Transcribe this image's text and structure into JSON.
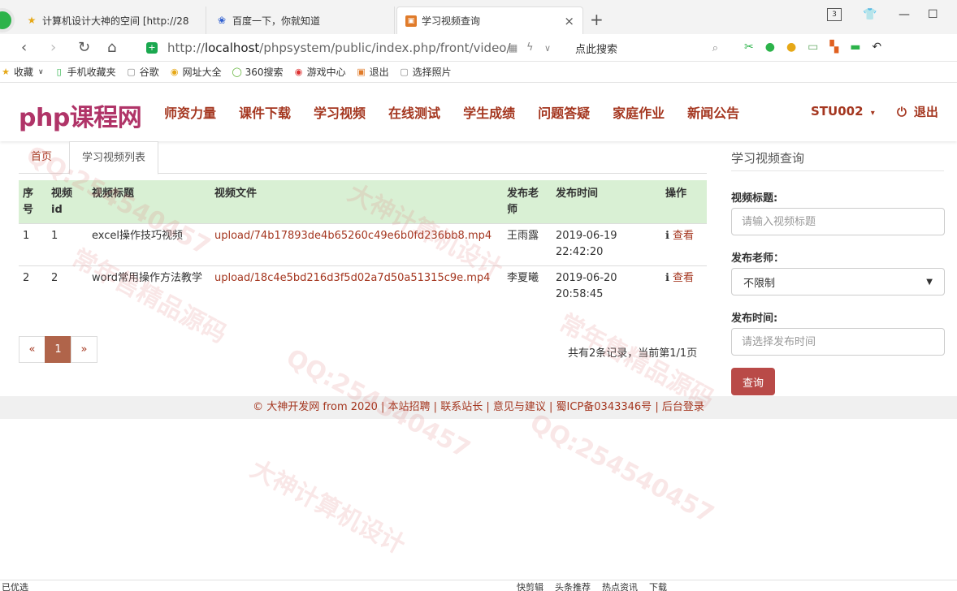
{
  "browser": {
    "tabs": [
      {
        "label": "计算机设计大神的空间 [http://28",
        "icon": "star-icon"
      },
      {
        "label": "百度一下，你就知道",
        "icon": "baidu-paw-icon"
      },
      {
        "label": "学习视频查询",
        "icon": "site-favicon-icon",
        "active": true
      }
    ],
    "tab_counter": "3",
    "new_tab_symbol": "+",
    "close_symbol": "×",
    "url_prefix": "http://",
    "url_host": "localhost",
    "url_path": "/phpsystem/public/index.php/front/video/",
    "search_placeholder": "点此搜索",
    "bookmarks": [
      "收藏",
      "手机收藏夹",
      "谷歌",
      "网址大全",
      "360搜索",
      "游戏中心",
      "退出",
      "选择照片"
    ]
  },
  "site": {
    "brand": "php课程网",
    "nav": [
      "师资力量",
      "课件下载",
      "学习视频",
      "在线测试",
      "学生成绩",
      "问题答疑",
      "家庭作业",
      "新闻公告"
    ],
    "user": "STU002",
    "logout": "退出",
    "accent": "#a4361f",
    "brand_color": "#b03468"
  },
  "content": {
    "tab_home": "首页",
    "tab_current": "学习视频列表",
    "table": {
      "headers": [
        "序号",
        "视频id",
        "视频标题",
        "视频文件",
        "发布老师",
        "发布时间",
        "操作"
      ],
      "rows": [
        {
          "no": "1",
          "id": "1",
          "title": "excel操作技巧视频",
          "file": "upload/74b17893de4b65260c49e6b0fd236bb8.mp4",
          "teacher": "王雨露",
          "date": "2019-06-19",
          "time": "22:42:20",
          "action": "查看"
        },
        {
          "no": "2",
          "id": "2",
          "title": "word常用操作方法教学",
          "file": "upload/18c4e5bd216d3f5d02a7d50a51315c9e.mp4",
          "teacher": "李夏曦",
          "date": "2019-06-20",
          "time": "20:58:45",
          "action": "查看"
        }
      ]
    },
    "pager": {
      "prev": "«",
      "current": "1",
      "next": "»"
    },
    "page_info": "共有2条记录，当前第1/1页"
  },
  "sidebar": {
    "title": "学习视频查询",
    "title_label": "视频标题:",
    "title_placeholder": "请输入视频标题",
    "teacher_label": "发布老师：",
    "teacher_value": "不限制",
    "time_label": "发布时间:",
    "time_placeholder": "请选择发布时间",
    "submit": "查询"
  },
  "footer": {
    "items": [
      "© 大神开发网 from 2020",
      "本站招聘",
      "联系站长",
      "意见与建议",
      "蜀ICP备0343346号",
      "后台登录"
    ]
  },
  "statusbar": {
    "left": "已优选",
    "items": [
      "快剪辑",
      "头条推荐",
      "热点资讯",
      "下载"
    ]
  },
  "watermarks": [
    "QQ:254540457",
    "大神计算机设计",
    "常年售精品源码"
  ]
}
